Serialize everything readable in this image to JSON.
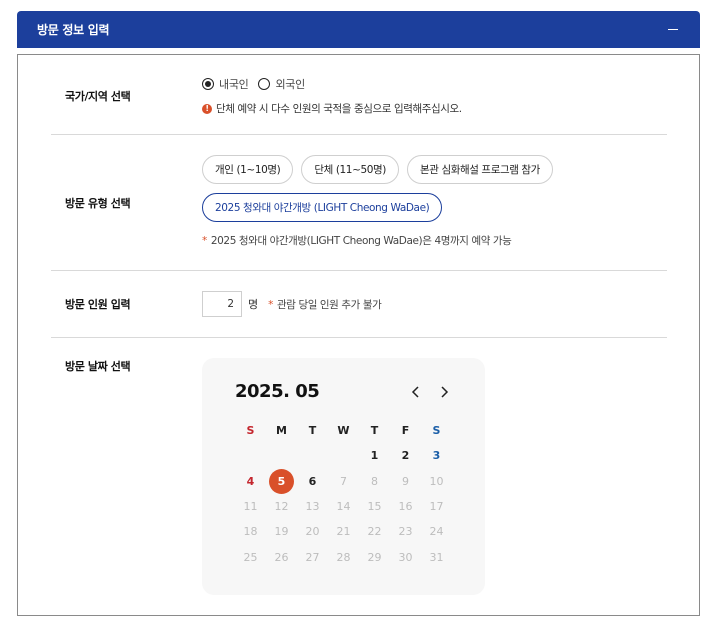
{
  "header": {
    "title": "방문 정보 입력"
  },
  "nationality": {
    "label": "국가/지역 선택",
    "options": [
      {
        "label": "내국인",
        "checked": true
      },
      {
        "label": "외국인",
        "checked": false
      }
    ],
    "info": "단체 예약 시 다수 인원의 국적을 중심으로 입력해주십시오.",
    "info_icon": "!"
  },
  "visit_type": {
    "label": "방문 유형 선택",
    "chips": [
      "개인 (1~10명)",
      "단체 (11~50명)",
      "본관 심화해설 프로그램 참가"
    ],
    "selected_chip": "2025 청와대 야간개방 (LIGHT Cheong WaDae)",
    "note_star": "*",
    "note": "2025 청와대 야간개방(LIGHT Cheong WaDae)은 4명까지 예약 가능"
  },
  "visitors": {
    "label": "방문 인원 입력",
    "value": "2",
    "unit": "명",
    "note_star": "*",
    "note": "관람 당일 인원 추가 불가"
  },
  "visit_date": {
    "label": "방문 날짜 선택",
    "calendar": {
      "title": "2025. 05",
      "weekdays": [
        "S",
        "M",
        "T",
        "W",
        "T",
        "F",
        "S"
      ],
      "weeks": [
        [
          "",
          "",
          "",
          "",
          "1",
          "2",
          "3"
        ],
        [
          "4",
          "5",
          "6",
          "7",
          "8",
          "9",
          "10"
        ],
        [
          "11",
          "12",
          "13",
          "14",
          "15",
          "16",
          "17"
        ],
        [
          "18",
          "19",
          "20",
          "21",
          "22",
          "23",
          "24"
        ],
        [
          "25",
          "26",
          "27",
          "28",
          "29",
          "30",
          "31"
        ]
      ],
      "available_days": [
        "1",
        "2",
        "3",
        "4",
        "5",
        "6"
      ],
      "selected_day": "5",
      "selected_color": "#d9502a"
    }
  },
  "colors": {
    "header_bg": "#1c3f9c",
    "accent": "#d9502a",
    "sunday": "#c4262e",
    "saturday": "#1c5fa8"
  }
}
